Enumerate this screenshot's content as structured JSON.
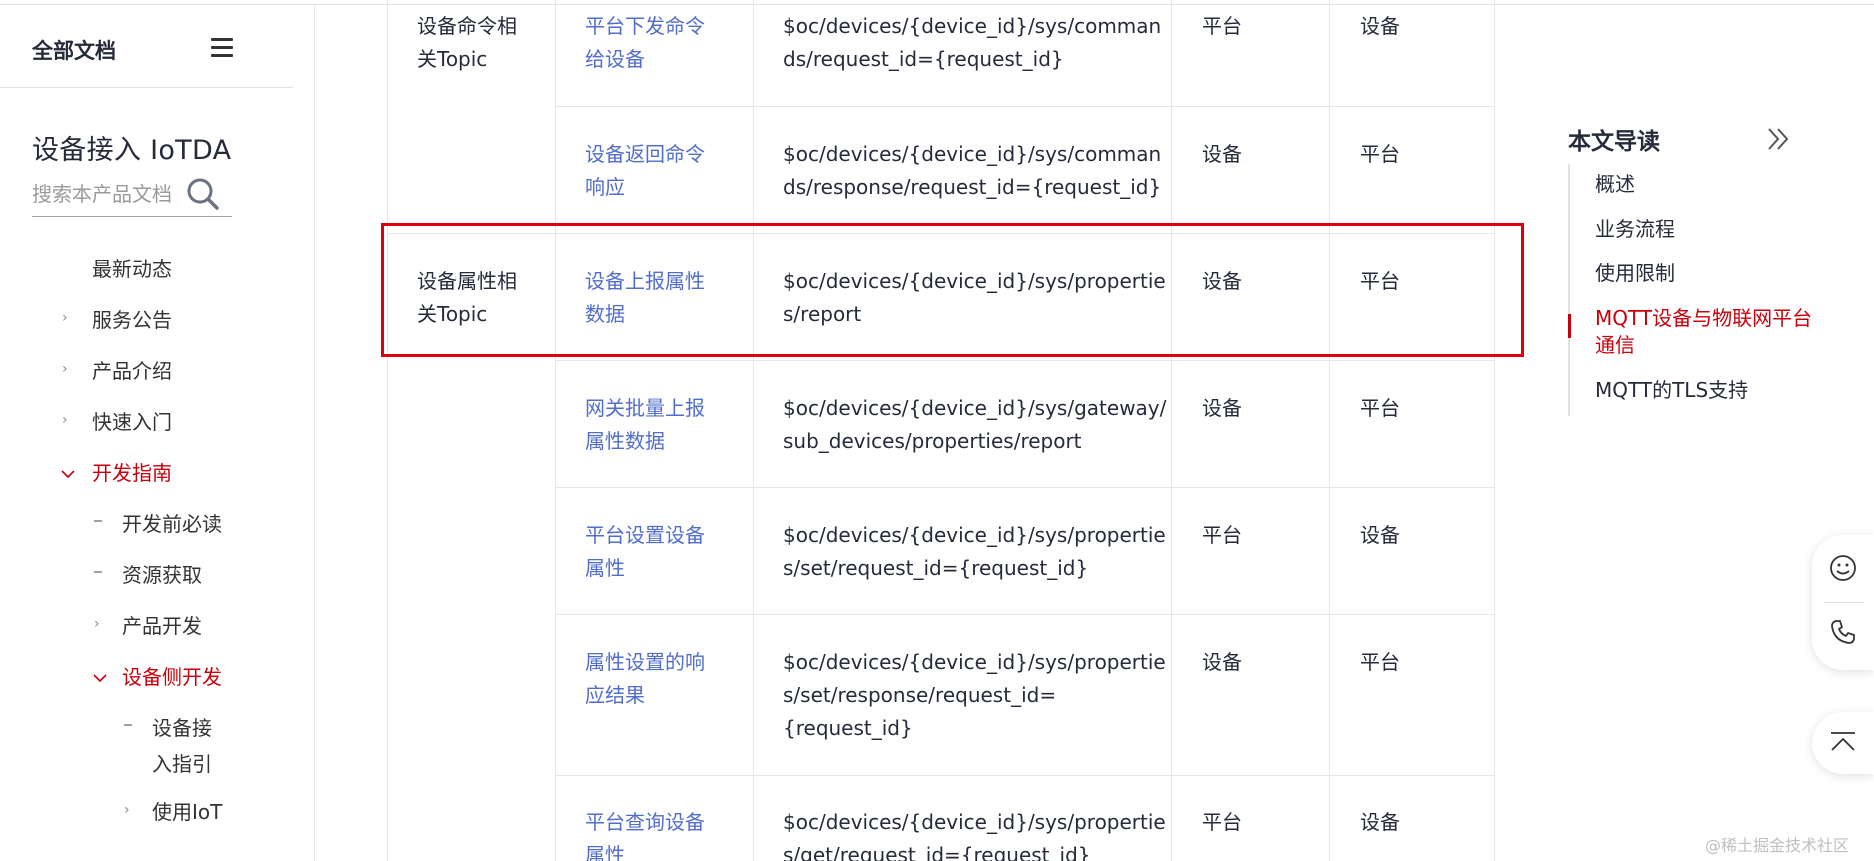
{
  "sidebar": {
    "header_title": "全部文档",
    "product_title": "设备接入 IoTDA",
    "search_placeholder": "搜索本产品文档",
    "items": [
      {
        "label": "最新动态"
      },
      {
        "label": "服务公告"
      },
      {
        "label": "产品介绍"
      },
      {
        "label": "快速入门"
      },
      {
        "label": "开发指南"
      },
      {
        "label": "开发前必读"
      },
      {
        "label": "资源获取"
      },
      {
        "label": "产品开发"
      },
      {
        "label": "设备侧开发"
      },
      {
        "label_line1": "设备接",
        "label_line2": "入指引"
      },
      {
        "label": "使用IoT"
      }
    ]
  },
  "table": {
    "groups": [
      {
        "line1": "设备命令相",
        "line2": "关Topic"
      },
      {
        "line1": "设备属性相",
        "line2": "关Topic"
      }
    ],
    "rows": [
      {
        "name1": "平台下发命令",
        "name2": "给设备",
        "topic1": "$oc/devices/{device_id}/sys/comman",
        "topic2": "ds/request_id={request_id}",
        "topic3": "",
        "publisher": "平台",
        "subscriber": "设备"
      },
      {
        "name1": "设备返回命令",
        "name2": "响应",
        "topic1": "$oc/devices/{device_id}/sys/comman",
        "topic2": "ds/response/request_id={request_id}",
        "topic3": "",
        "publisher": "设备",
        "subscriber": "平台"
      },
      {
        "name1": "设备上报属性",
        "name2": "数据",
        "topic1": "$oc/devices/{device_id}/sys/propertie",
        "topic2": "s/report",
        "topic3": "",
        "publisher": "设备",
        "subscriber": "平台"
      },
      {
        "name1": "网关批量上报",
        "name2": "属性数据",
        "topic1": "$oc/devices/{device_id}/sys/gateway/",
        "topic2": "sub_devices/properties/report",
        "topic3": "",
        "publisher": "设备",
        "subscriber": "平台"
      },
      {
        "name1": "平台设置设备",
        "name2": "属性",
        "topic1": "$oc/devices/{device_id}/sys/propertie",
        "topic2": "s/set/request_id={request_id}",
        "topic3": "",
        "publisher": "平台",
        "subscriber": "设备"
      },
      {
        "name1": "属性设置的响",
        "name2": "应结果",
        "topic1": "$oc/devices/{device_id}/sys/propertie",
        "topic2": "s/set/response/request_id=",
        "topic3": "{request_id}",
        "publisher": "设备",
        "subscriber": "平台"
      },
      {
        "name1": "平台查询设备",
        "name2": "属性",
        "topic1": "$oc/devices/{device_id}/sys/propertie",
        "topic2": "s/get/request_id={request_id}",
        "topic3": "",
        "publisher": "平台",
        "subscriber": "设备"
      }
    ]
  },
  "toc": {
    "title": "本文导读",
    "items": [
      {
        "label": "概述"
      },
      {
        "label": "业务流程"
      },
      {
        "label": "使用限制"
      },
      {
        "label_line1": "MQTT设备与物联网平台",
        "label_line2": "通信"
      },
      {
        "label": "MQTT的TLS支持"
      }
    ]
  },
  "watermark": "@稀土掘金技术社区",
  "colors": {
    "accent": "#c7000b",
    "link": "#526ecc",
    "highlight_border": "#e0000d"
  }
}
